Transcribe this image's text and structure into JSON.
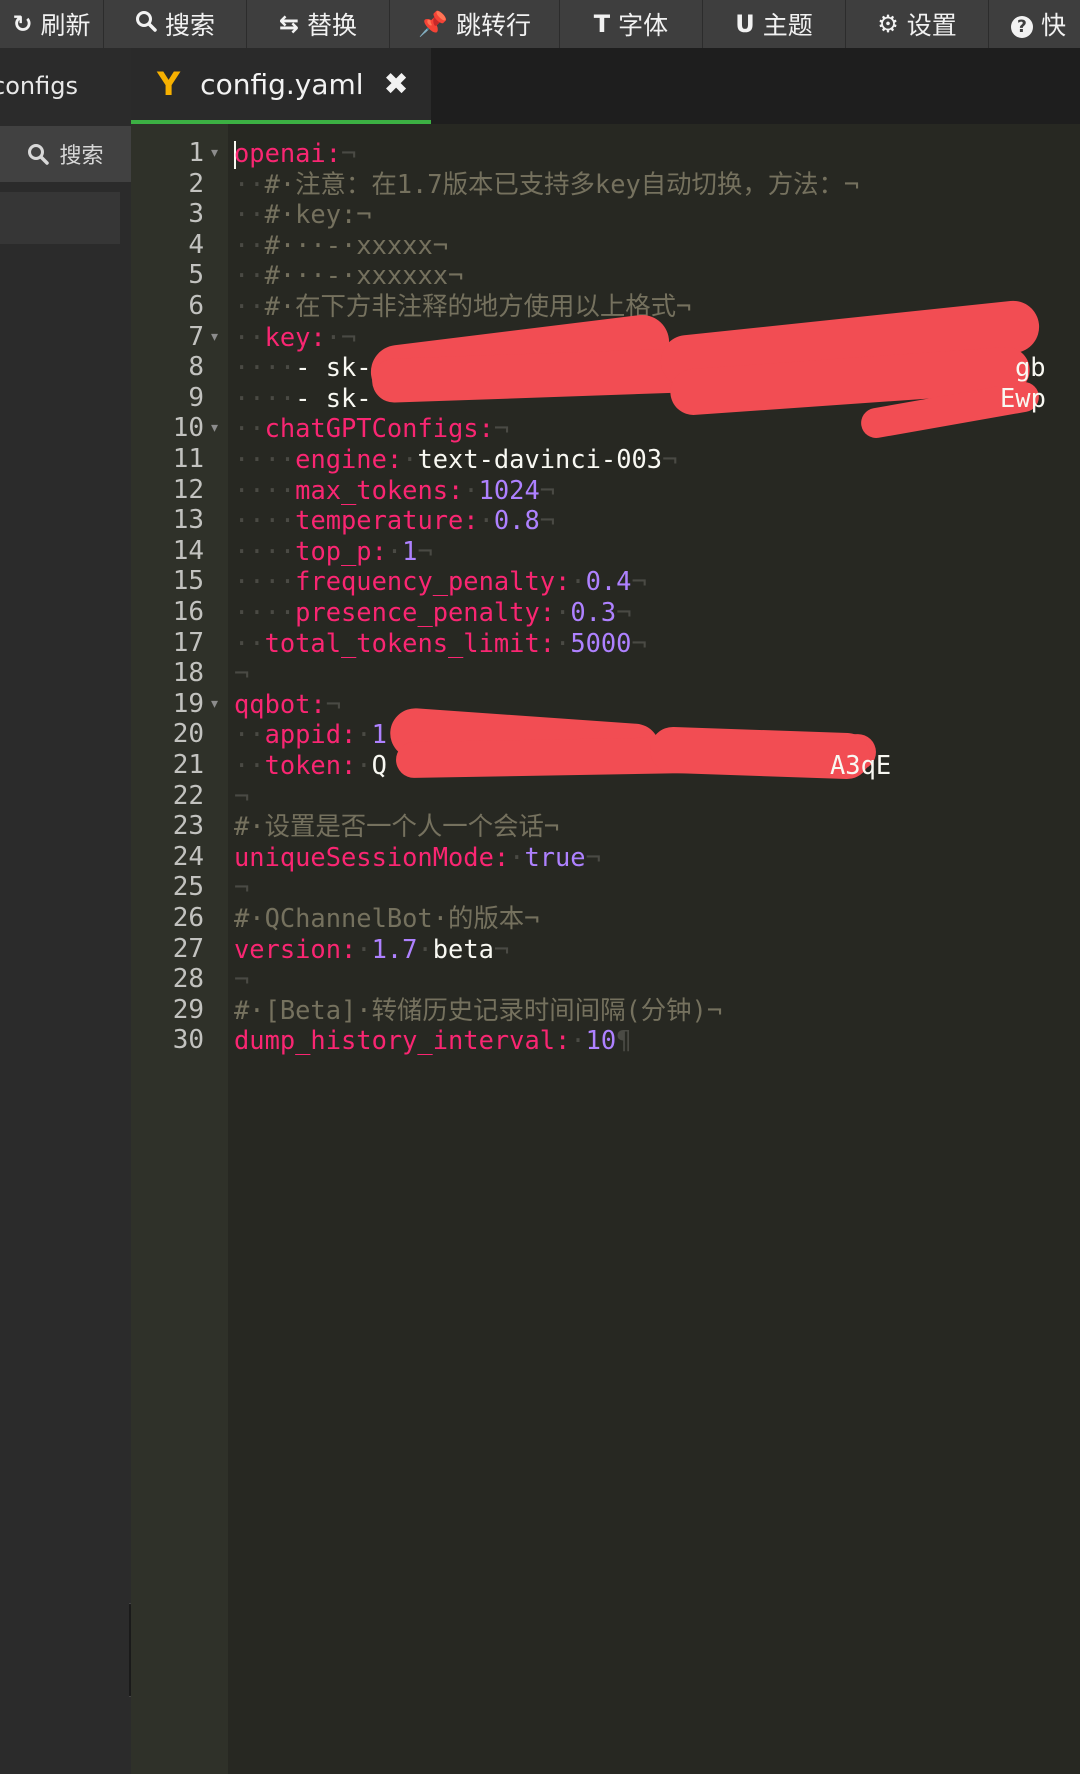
{
  "toolbar": {
    "items": [
      {
        "icon": "refresh-icon",
        "glyph": "↻",
        "label": "刷新"
      },
      {
        "icon": "search-icon",
        "glyph": "",
        "label": "搜索"
      },
      {
        "icon": "replace-icon",
        "glyph": "⇆",
        "label": "替换"
      },
      {
        "icon": "pin-icon",
        "glyph": "📌",
        "label": "跳转行"
      },
      {
        "icon": "font-icon",
        "glyph": "T",
        "label": "字体"
      },
      {
        "icon": "magnet-icon",
        "glyph": "U",
        "label": "主题"
      },
      {
        "icon": "gear-icon",
        "glyph": "⚙",
        "label": "设置"
      },
      {
        "icon": "help-icon",
        "glyph": "?",
        "label": "快"
      }
    ]
  },
  "sidebar": {
    "folder": "configs",
    "search_label": "搜索"
  },
  "tab": {
    "filename": "config.yaml"
  },
  "editor": {
    "lines": [
      {
        "n": "1",
        "fold": true,
        "tokens": [
          [
            "cursor",
            ""
          ],
          [
            "k",
            "openai:"
          ],
          [
            "ws",
            "¬"
          ]
        ]
      },
      {
        "n": "2",
        "fold": false,
        "tokens": [
          [
            "ws",
            "··"
          ],
          [
            "c",
            "#·注意：在1.7版本已支持多key自动切换，方法：¬"
          ]
        ]
      },
      {
        "n": "3",
        "fold": false,
        "tokens": [
          [
            "ws",
            "··"
          ],
          [
            "c",
            "#·key:¬"
          ]
        ]
      },
      {
        "n": "4",
        "fold": false,
        "tokens": [
          [
            "ws",
            "··"
          ],
          [
            "c",
            "#···-·xxxxx¬"
          ]
        ]
      },
      {
        "n": "5",
        "fold": false,
        "tokens": [
          [
            "ws",
            "··"
          ],
          [
            "c",
            "#···-·xxxxxx¬"
          ]
        ]
      },
      {
        "n": "6",
        "fold": false,
        "tokens": [
          [
            "ws",
            "··"
          ],
          [
            "c",
            "#·在下方非注释的地方使用以上格式¬"
          ]
        ]
      },
      {
        "n": "7",
        "fold": true,
        "tokens": [
          [
            "ws",
            "··"
          ],
          [
            "k",
            "key:"
          ],
          [
            "ws",
            "·¬"
          ]
        ]
      },
      {
        "n": "8",
        "fold": false,
        "tokens": [
          [
            "ws",
            "····"
          ],
          [
            "w",
            "- sk-"
          ]
        ]
      },
      {
        "n": "9",
        "fold": false,
        "tokens": [
          [
            "ws",
            "····"
          ],
          [
            "w",
            "- sk-"
          ]
        ]
      },
      {
        "n": "10",
        "fold": true,
        "tokens": [
          [
            "ws",
            "··"
          ],
          [
            "k",
            "chatGPTConfigs:"
          ],
          [
            "ws",
            "¬"
          ]
        ]
      },
      {
        "n": "11",
        "fold": false,
        "tokens": [
          [
            "ws",
            "····"
          ],
          [
            "k",
            "engine:"
          ],
          [
            "ws",
            "·"
          ],
          [
            "w",
            "text-davinci-003"
          ],
          [
            "ws",
            "¬"
          ]
        ]
      },
      {
        "n": "12",
        "fold": false,
        "tokens": [
          [
            "ws",
            "····"
          ],
          [
            "k",
            "max_tokens:"
          ],
          [
            "ws",
            "·"
          ],
          [
            "n",
            "1024"
          ],
          [
            "ws",
            "¬"
          ]
        ]
      },
      {
        "n": "13",
        "fold": false,
        "tokens": [
          [
            "ws",
            "····"
          ],
          [
            "k",
            "temperature:"
          ],
          [
            "ws",
            "·"
          ],
          [
            "n",
            "0.8"
          ],
          [
            "ws",
            "¬"
          ]
        ]
      },
      {
        "n": "14",
        "fold": false,
        "tokens": [
          [
            "ws",
            "····"
          ],
          [
            "k",
            "top_p:"
          ],
          [
            "ws",
            "·"
          ],
          [
            "n",
            "1"
          ],
          [
            "ws",
            "¬"
          ]
        ]
      },
      {
        "n": "15",
        "fold": false,
        "tokens": [
          [
            "ws",
            "····"
          ],
          [
            "k",
            "frequency_penalty:"
          ],
          [
            "ws",
            "·"
          ],
          [
            "n",
            "0.4"
          ],
          [
            "ws",
            "¬"
          ]
        ]
      },
      {
        "n": "16",
        "fold": false,
        "tokens": [
          [
            "ws",
            "····"
          ],
          [
            "k",
            "presence_penalty:"
          ],
          [
            "ws",
            "·"
          ],
          [
            "n",
            "0.3"
          ],
          [
            "ws",
            "¬"
          ]
        ]
      },
      {
        "n": "17",
        "fold": false,
        "tokens": [
          [
            "ws",
            "··"
          ],
          [
            "k",
            "total_tokens_limit:"
          ],
          [
            "ws",
            "·"
          ],
          [
            "n",
            "5000"
          ],
          [
            "ws",
            "¬"
          ]
        ]
      },
      {
        "n": "18",
        "fold": false,
        "tokens": [
          [
            "ws",
            "¬"
          ]
        ]
      },
      {
        "n": "19",
        "fold": true,
        "tokens": [
          [
            "k",
            "qqbot:"
          ],
          [
            "ws",
            "¬"
          ]
        ]
      },
      {
        "n": "20",
        "fold": false,
        "tokens": [
          [
            "ws",
            "··"
          ],
          [
            "k",
            "appid:"
          ],
          [
            "ws",
            "·"
          ],
          [
            "n",
            "1"
          ]
        ]
      },
      {
        "n": "21",
        "fold": false,
        "tokens": [
          [
            "ws",
            "··"
          ],
          [
            "k",
            "token:"
          ],
          [
            "ws",
            "·"
          ],
          [
            "w",
            "Q"
          ]
        ]
      },
      {
        "n": "22",
        "fold": false,
        "tokens": [
          [
            "ws",
            "¬"
          ]
        ]
      },
      {
        "n": "23",
        "fold": false,
        "tokens": [
          [
            "c",
            "#·设置是否一个人一个会话¬"
          ]
        ]
      },
      {
        "n": "24",
        "fold": false,
        "tokens": [
          [
            "k",
            "uniqueSessionMode:"
          ],
          [
            "ws",
            "·"
          ],
          [
            "n",
            "true"
          ],
          [
            "ws",
            "¬"
          ]
        ]
      },
      {
        "n": "25",
        "fold": false,
        "tokens": [
          [
            "ws",
            "¬"
          ]
        ]
      },
      {
        "n": "26",
        "fold": false,
        "tokens": [
          [
            "c",
            "#·QChannelBot·的版本¬"
          ]
        ]
      },
      {
        "n": "27",
        "fold": false,
        "tokens": [
          [
            "k",
            "version:"
          ],
          [
            "ws",
            "·"
          ],
          [
            "n",
            "1.7"
          ],
          [
            "ws",
            "·"
          ],
          [
            "w",
            "beta"
          ],
          [
            "ws",
            "¬"
          ]
        ]
      },
      {
        "n": "28",
        "fold": false,
        "tokens": [
          [
            "ws",
            "¬"
          ]
        ]
      },
      {
        "n": "29",
        "fold": false,
        "tokens": [
          [
            "c",
            "#·[Beta]·转储历史记录时间间隔(分钟)¬"
          ]
        ]
      },
      {
        "n": "30",
        "fold": false,
        "tokens": [
          [
            "k",
            "dump_history_interval:"
          ],
          [
            "ws",
            "·"
          ],
          [
            "n",
            "10"
          ],
          [
            "ws",
            "¶"
          ]
        ]
      }
    ],
    "redacted_fragments": [
      {
        "line": "8",
        "text": "gb"
      },
      {
        "line": "9",
        "text": "Ewp"
      },
      {
        "line": "21",
        "text": "A3qE"
      }
    ]
  },
  "colors": {
    "keyword": "#f92672",
    "comment": "#75715e",
    "number": "#ae81ff",
    "text": "#f8f8f2",
    "background": "#272822",
    "gutter": "#2f3129",
    "active_tab_border": "#3cb043",
    "redaction": "#f24d53"
  }
}
